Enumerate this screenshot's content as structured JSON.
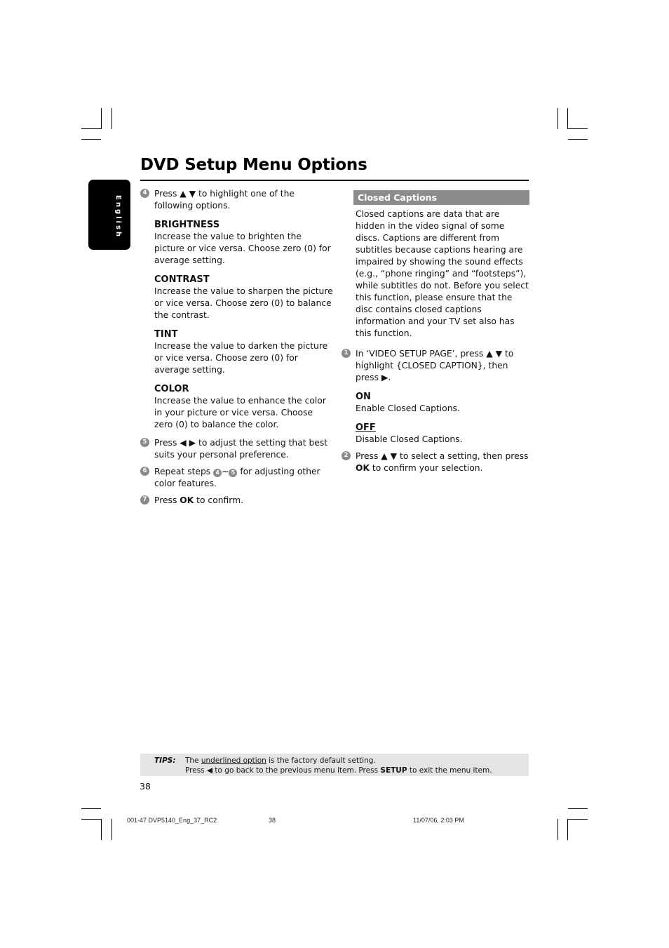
{
  "page": {
    "title": "DVD Setup Menu Options",
    "language_tab": "English",
    "page_number": "38"
  },
  "left_column": {
    "step4": {
      "num": "4",
      "text_before": "Press ",
      "arrows": "▲ ▼",
      "text_after": " to highlight one of the following options."
    },
    "options": [
      {
        "title": "BRIGHTNESS",
        "desc": "Increase the value to brighten the picture or vice versa. Choose zero (0) for average setting."
      },
      {
        "title": "CONTRAST",
        "desc": "Increase the value to sharpen the picture or vice versa.  Choose zero (0) to balance the contrast."
      },
      {
        "title": "TINT",
        "desc": "Increase the value to darken the picture or vice versa.  Choose zero (0) for average setting."
      },
      {
        "title": "COLOR",
        "desc": "Increase the value to enhance the color in your picture or vice versa. Choose zero (0) to balance the color."
      }
    ],
    "step5": {
      "num": "5",
      "text_before": "Press ",
      "arrows": "◀ ▶",
      "text_after": " to adjust the setting that best suits your personal preference."
    },
    "step6": {
      "num": "6",
      "text_before": "Repeat steps ",
      "ref_from": "4",
      "tilde": "~",
      "ref_to": "5",
      "text_after": " for adjusting other color features."
    },
    "step7": {
      "num": "7",
      "text_before": "Press ",
      "bold": "OK",
      "text_after": " to confirm."
    }
  },
  "right_column": {
    "section_title": "Closed Captions",
    "intro": "Closed captions are data that are hidden in the video signal of some discs. Captions are different from subtitles because captions hearing are impaired by showing the sound effects (e.g., “phone ringing” and “footsteps”), while subtitles do not. Before you select this function, please ensure that the disc contains closed captions information and your TV set also has this function.",
    "step1": {
      "num": "1",
      "text_before": "In ‘VIDEO SETUP PAGE’, press ",
      "arrows": "▲ ▼",
      "text_mid": " to highlight {CLOSED CAPTION}, then press ",
      "arrow_right": "▶",
      "text_after": "."
    },
    "options": [
      {
        "title": "ON",
        "desc": "Enable Closed Captions.",
        "default": false
      },
      {
        "title": "OFF",
        "desc": "Disable Closed Captions.",
        "default": true
      }
    ],
    "step2": {
      "num": "2",
      "text_before": "Press ",
      "arrows": "▲ ▼",
      "text_mid": " to select a setting, then press ",
      "bold": "OK",
      "text_after": " to confirm your selection."
    }
  },
  "tips": {
    "label": "TIPS:",
    "line1_before": "The ",
    "line1_underlined": "underlined option",
    "line1_after": " is the factory default setting.",
    "line2_before": "Press ",
    "line2_arrow": "◀",
    "line2_mid": " to go back to the previous menu item. Press ",
    "line2_bold": "SETUP",
    "line2_after": " to exit the menu item."
  },
  "footer": {
    "file": "001-47 DVP5140_Eng_37_RC2",
    "page": "38",
    "datetime": "11/07/06, 2:03 PM"
  }
}
